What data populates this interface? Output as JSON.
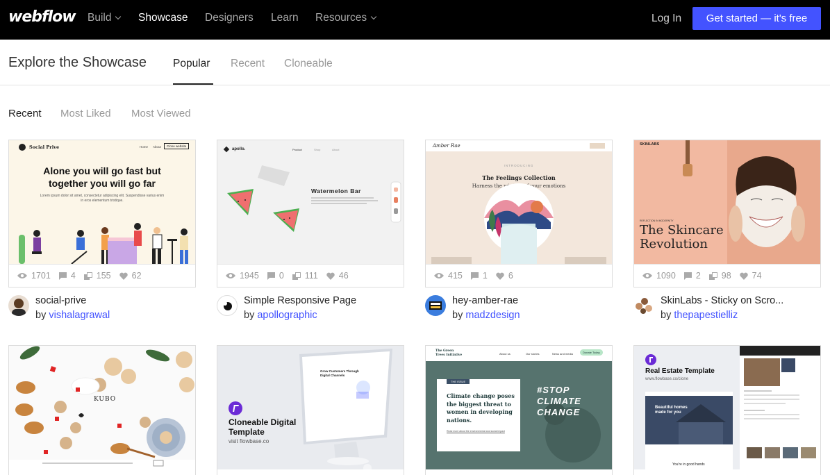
{
  "nav": {
    "logo": "webflow",
    "links": [
      "Build",
      "Showcase",
      "Designers",
      "Learn",
      "Resources"
    ],
    "login": "Log In",
    "cta": "Get started — it's free"
  },
  "subheader": {
    "title": "Explore the Showcase",
    "tabs": [
      "Popular",
      "Recent",
      "Cloneable"
    ]
  },
  "filters": [
    "Recent",
    "Most Liked",
    "Most Viewed"
  ],
  "cards": [
    {
      "title": "social-prive",
      "by": "by",
      "author": "vishalagrawal",
      "views": "1701",
      "comments": "4",
      "clones": "155",
      "likes": "62",
      "thumb": {
        "brand": "Social Prive",
        "nav": [
          "Home",
          "About",
          "Clone website"
        ],
        "headline": "Alone you will go fast but together you will go far",
        "body": "Lorem ipsum dolor sit amet, consectetur adipiscing elit. Suspendisse varius enim in eros elementum tristique."
      }
    },
    {
      "title": "Simple Responsive Page",
      "by": "by",
      "author": "apollographic",
      "views": "1945",
      "comments": "0",
      "clones": "111",
      "likes": "46",
      "thumb": {
        "brand": "apollo.",
        "nav": [
          "Product",
          "Shop",
          "About"
        ],
        "headline": "Watermelon Bar"
      }
    },
    {
      "title": "hey-amber-rae",
      "by": "by",
      "author": "madzdesign",
      "views": "415",
      "comments": "1",
      "likes": "6",
      "thumb": {
        "brand": "Amber Rae",
        "kicker": "INTRODUCING",
        "headline": "The Feelings Collection",
        "sub": "Harness the wisdom of your emotions"
      }
    },
    {
      "title": "SkinLabs - Sticky on Scro...",
      "by": "by",
      "author": "thepapestielliz",
      "views": "1090",
      "comments": "2",
      "clones": "98",
      "likes": "74",
      "thumb": {
        "brand": "SKINLABS",
        "kicker": "REFLECTION IN MODERNITY",
        "headline": "The Skincare Revolution"
      }
    },
    {
      "thumb": {
        "brand": "KUBO"
      }
    },
    {
      "thumb": {
        "headline": "Cloneable Digital Template",
        "sub": "visit flowbase.co",
        "screen": "Grow Customers Through Digital Channels"
      }
    },
    {
      "thumb": {
        "brand": "The Green Trees Initiative",
        "nav": [
          "About us",
          "Our stories",
          "News and media",
          "Donate Today"
        ],
        "tag": "THE ISSUE",
        "headline": "Climate change poses the biggest threat to women in developing nations.",
        "link": "Read more about the environmental and social impact",
        "overlay": "#STOP CLIMATE CHANGE"
      }
    },
    {
      "thumb": {
        "headline": "Real Estate Template",
        "sub": "www.flowbase.co/clone",
        "hero": "Beautiful homes made for you",
        "footer": "You're in good hands"
      }
    }
  ]
}
